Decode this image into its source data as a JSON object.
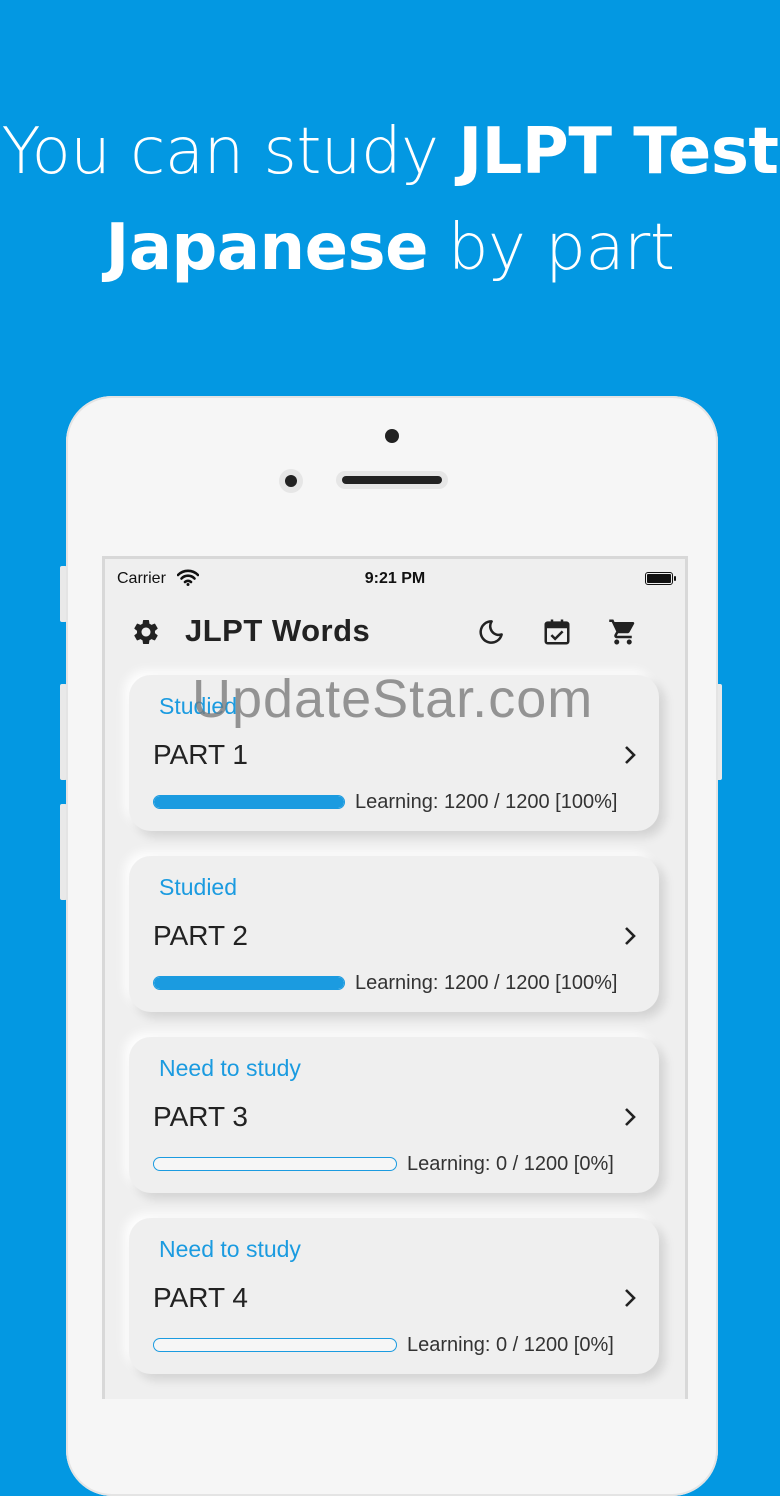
{
  "headline": {
    "line1_regular": "You can study ",
    "line1_bold": "JLPT Test",
    "line2_bold": "Japanese",
    "line2_regular": " by part"
  },
  "status_bar": {
    "carrier": "Carrier",
    "time": "9:21 PM"
  },
  "app_bar": {
    "title": "JLPT Words",
    "icons": [
      "gear-icon",
      "moon-icon",
      "calendar-check-icon",
      "cart-icon"
    ]
  },
  "parts": [
    {
      "status": "Studied",
      "title": "PART 1",
      "progress_text": "Learning: 1200 / 1200 [100%]",
      "progress": 1.0
    },
    {
      "status": "Studied",
      "title": "PART 2",
      "progress_text": "Learning: 1200 / 1200 [100%]",
      "progress": 1.0
    },
    {
      "status": "Need to study",
      "title": "PART 3",
      "progress_text": "Learning: 0 / 1200 [0%]",
      "progress": 0.0
    },
    {
      "status": "Need to study",
      "title": "PART 4",
      "progress_text": "Learning: 0 / 1200 [0%]",
      "progress": 0.0
    }
  ],
  "watermark": "UpdateStar.com",
  "colors": {
    "background": "#0398e2",
    "accent": "#1b9be0"
  }
}
